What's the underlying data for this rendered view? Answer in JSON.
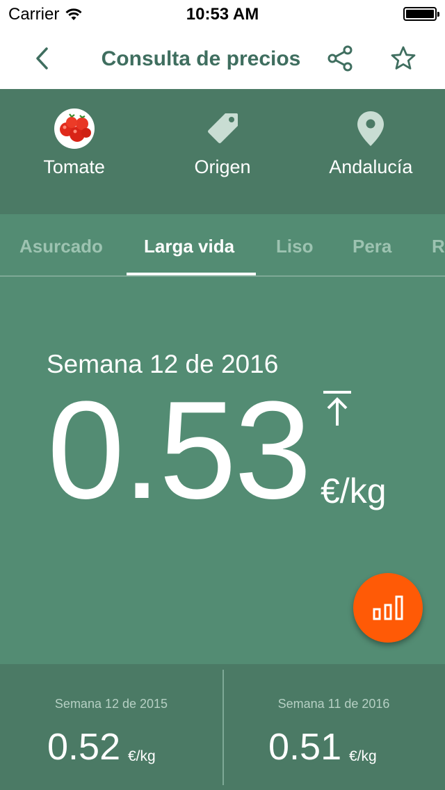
{
  "status_bar": {
    "carrier": "Carrier",
    "time": "10:53 AM",
    "battery_level": 1.0
  },
  "nav": {
    "title": "Consulta de precios",
    "back_icon": "chevron-left-icon",
    "share_icon": "share-icon",
    "favorite_icon": "star-icon"
  },
  "filters": [
    {
      "label": "Tomate",
      "icon": "tomato-image"
    },
    {
      "label": "Origen",
      "icon": "tag-icon"
    },
    {
      "label": "Andalucía",
      "icon": "location-pin-icon"
    }
  ],
  "tabs": {
    "items": [
      "Asurcado",
      "Larga vida",
      "Liso",
      "Pera",
      "R"
    ],
    "active": "Larga vida"
  },
  "current": {
    "week": "Semana 12 de 2016",
    "price": "0.53",
    "unit": "€/kg",
    "trend_icon": "arrow-up-to-top-icon"
  },
  "chart_button_icon": "bar-chart-icon",
  "comparisons": [
    {
      "week": "Semana 12 de 2015",
      "price": "0.52",
      "unit": "€/kg"
    },
    {
      "week": "Semana 11 de 2016",
      "price": "0.51",
      "unit": "€/kg"
    }
  ],
  "colors": {
    "header_green": "#4b7a65",
    "main_green": "#538c73",
    "title_text": "#3f6e5f",
    "accent_orange": "#ff5a06"
  }
}
